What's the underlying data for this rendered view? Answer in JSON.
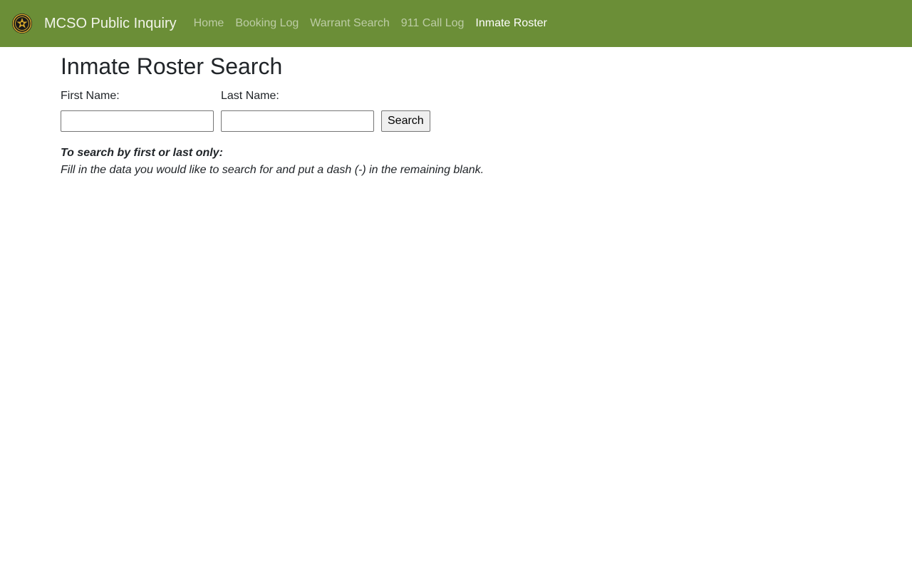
{
  "navbar": {
    "brand_text": "MCSO Public Inquiry",
    "bg_color": "#6b8e37",
    "logo_icon": "sheriff-badge-icon",
    "links": [
      {
        "label": "Home",
        "active": false
      },
      {
        "label": "Booking Log",
        "active": false
      },
      {
        "label": "Warrant Search",
        "active": false
      },
      {
        "label": "911 Call Log",
        "active": false
      },
      {
        "label": "Inmate Roster",
        "active": true
      }
    ]
  },
  "main": {
    "title": "Inmate Roster Search",
    "form": {
      "first_name_label": "First Name:",
      "first_name_value": "",
      "last_name_label": "Last Name:",
      "last_name_value": "",
      "search_label": "Search"
    },
    "help": {
      "title": "To search by first or last only:",
      "text": "Fill in the data you would like to search for and put a dash (-) in the remaining blank."
    }
  }
}
